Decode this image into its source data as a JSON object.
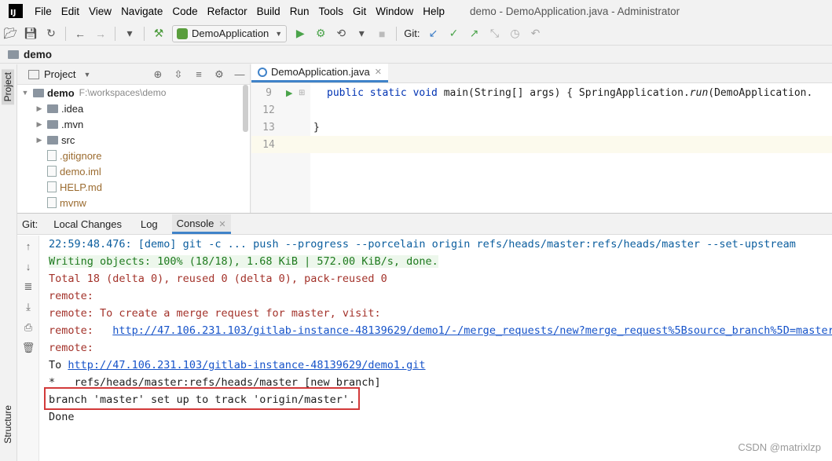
{
  "menubar": {
    "logo": "IJ",
    "items": [
      "File",
      "Edit",
      "View",
      "Navigate",
      "Code",
      "Refactor",
      "Build",
      "Run",
      "Tools",
      "Git",
      "Window",
      "Help"
    ],
    "window_title": "demo - DemoApplication.java - Administrator"
  },
  "toolbar": {
    "run_config": "DemoApplication",
    "git_label": "Git:"
  },
  "breadcrumb": {
    "project": "demo"
  },
  "left_stripe": {
    "project_tab": "Project",
    "structure_tab": "Structure"
  },
  "project_panel": {
    "title": "Project",
    "tree": [
      {
        "label": "demo",
        "path": "F:\\workspaces\\demo",
        "kind": "root"
      },
      {
        "label": ".idea",
        "kind": "folder"
      },
      {
        "label": ".mvn",
        "kind": "folder"
      },
      {
        "label": "src",
        "kind": "folder"
      },
      {
        "label": ".gitignore",
        "kind": "file-ignored"
      },
      {
        "label": "demo.iml",
        "kind": "file"
      },
      {
        "label": "HELP.md",
        "kind": "file"
      },
      {
        "label": "mvnw",
        "kind": "file"
      }
    ]
  },
  "editor": {
    "tab_label": "DemoApplication.java",
    "lines": [
      {
        "num": "9",
        "kw": "public static void ",
        "rest": "main(String[] args) { SpringApplication.",
        "em": "run",
        "tail": "(DemoApplication."
      },
      {
        "num": "12",
        "text": ""
      },
      {
        "num": "13",
        "text": "}"
      },
      {
        "num": "14",
        "text": ""
      }
    ]
  },
  "git_panel": {
    "label": "Git:",
    "tabs": [
      "Local Changes",
      "Log",
      "Console"
    ],
    "console": {
      "line1": "22:59:48.476: [demo] git -c ... push --progress --porcelain origin refs/heads/master:refs/heads/master --set-upstream",
      "line2": "Writing objects: 100% (18/18), 1.68 KiB | 572.00 KiB/s, done.",
      "line3": "Total 18 (delta 0), reused 0 (delta 0), pack-reused 0",
      "line4": "remote:",
      "line5": "remote: To create a merge request for master, visit:",
      "line6_prefix": "remote:   ",
      "line6_link": "http://47.106.231.103/gitlab-instance-48139629/demo1/-/merge_requests/new?merge_request%5Bsource_branch%5D=master",
      "line7": "remote:",
      "line8_prefix": "To ",
      "line8_link": "http://47.106.231.103/gitlab-instance-48139629/demo1.git",
      "line9": "*   refs/heads/master:refs/heads/master [new branch]",
      "line10": "branch 'master' set up to track 'origin/master'.",
      "line11": "Done"
    }
  },
  "watermark": "CSDN @matrixlzp"
}
